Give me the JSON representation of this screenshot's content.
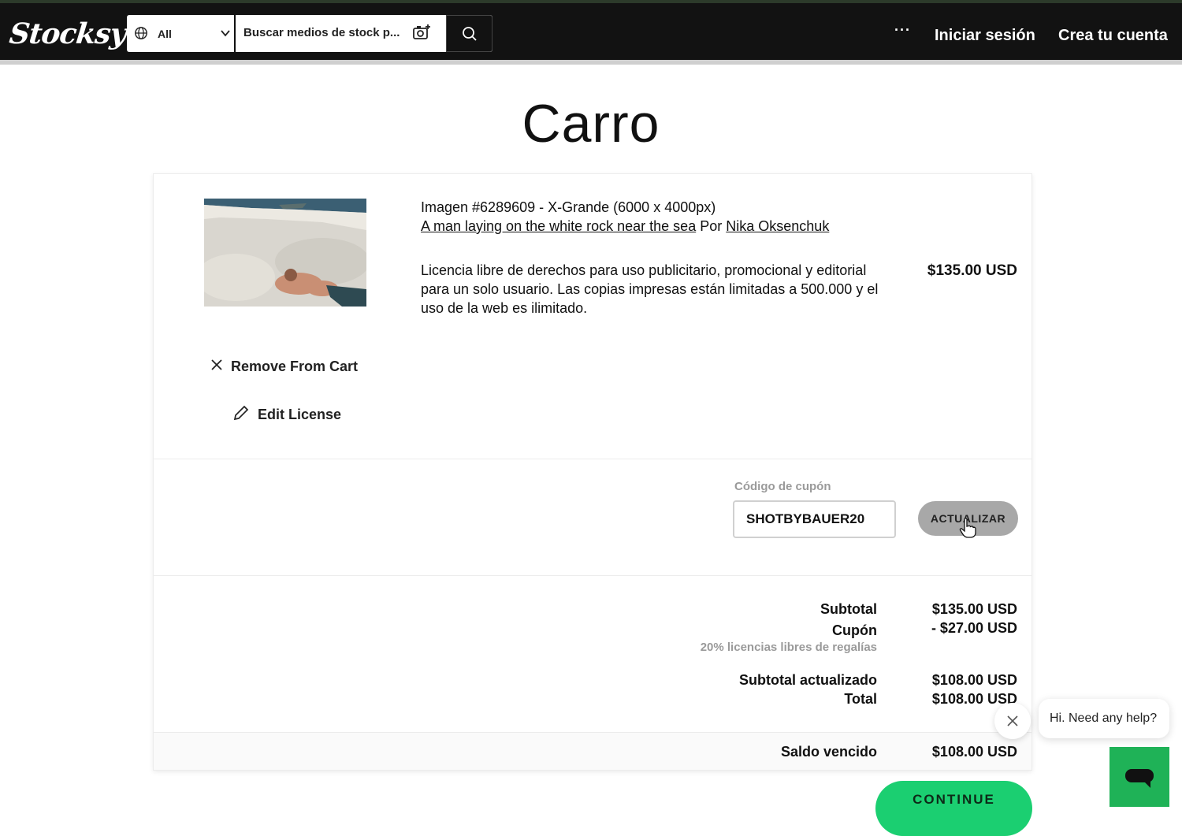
{
  "header": {
    "logo_text": "Stocksy",
    "search": {
      "filter_label": "All",
      "placeholder": "Buscar medios de stock p..."
    },
    "more_label": "···",
    "login_label": "Iniciar sesión",
    "signup_label": "Crea tu cuenta"
  },
  "page_title": "Carro",
  "cart_item": {
    "title": "Imagen #6289609 - X-Grande (6000 x 4000px)",
    "image_link": "A man laying on the white rock near the sea",
    "by_label": "Por",
    "author": "Nika Oksenchuk",
    "license_text": "Licencia libre de derechos para uso publicitario, promocional y editorial para un solo usuario. Las copias impresas están limitadas a 500.000 y el uso de la web es ilimitado.",
    "price": "$135.00 USD",
    "remove_label": "Remove From Cart",
    "edit_label": "Edit License"
  },
  "coupon": {
    "label": "Código de cupón",
    "value": "SHOTBYBAUER20",
    "update_label": "ACTUALIZAR"
  },
  "summary": {
    "subtotal_label": "Subtotal",
    "subtotal_value": "$135.00 USD",
    "coupon_label": "Cupón",
    "coupon_value": "- $27.00 USD",
    "coupon_note": "20% licencias libres de regalías",
    "updated_subtotal_label": "Subtotal actualizado",
    "updated_subtotal_value": "$108.00 USD",
    "total_label": "Total",
    "total_value": "$108.00 USD",
    "due_label": "Saldo vencido",
    "due_value": "$108.00 USD"
  },
  "continue_label": "CONTINUE",
  "help": {
    "bubble_text": "Hi. Need any help?"
  },
  "colors": {
    "navbar": "#121212",
    "continue_button": "#1bcf71",
    "chat_button": "#1fb257",
    "update_button": "#a8a8a8"
  }
}
